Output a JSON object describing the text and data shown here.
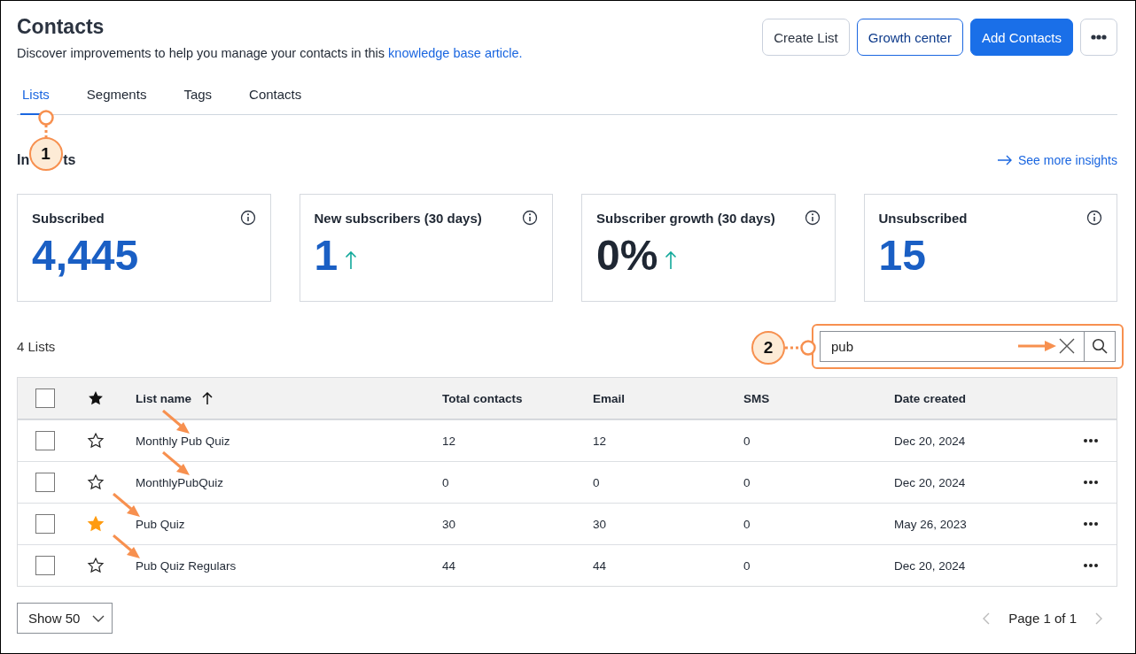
{
  "page": {
    "title": "Contacts",
    "description": "Discover improvements to help you manage your contacts in this ",
    "description_link": "knowledge base article."
  },
  "header_buttons": [
    {
      "label": "Create List",
      "kind": "secondary"
    },
    {
      "label": "Growth center",
      "kind": "outline"
    },
    {
      "label": "Add Contacts",
      "kind": "primary"
    }
  ],
  "tabs": [
    {
      "label": "Lists",
      "selected": true
    },
    {
      "label": "Segments",
      "selected": false
    },
    {
      "label": "Tags",
      "selected": false
    },
    {
      "label": "Contacts",
      "selected": false
    }
  ],
  "insights": {
    "heading_visible_parts": [
      "In",
      "ts"
    ],
    "link": "See more insights"
  },
  "cards": [
    {
      "label": "Subscribed",
      "value": "4,445",
      "kind": "count",
      "trend_up": false
    },
    {
      "label": "New subscribers (30 days)",
      "value": "1",
      "kind": "count",
      "trend_up": true
    },
    {
      "label": "Subscriber growth (30 days)",
      "value": "0%",
      "kind": "percent",
      "trend_up": true
    },
    {
      "label": "Unsubscribed",
      "value": "15",
      "kind": "count",
      "trend_up": false
    }
  ],
  "list_count": "4 Lists",
  "search": {
    "value": "pub"
  },
  "table": {
    "header_checked": false,
    "columns": [
      {
        "label": "List name",
        "sorted": true
      },
      {
        "label": "Total contacts",
        "sorted": false
      },
      {
        "label": "Email",
        "sorted": false
      },
      {
        "label": "SMS",
        "sorted": false
      },
      {
        "label": "Date created",
        "sorted": false
      }
    ],
    "rows": [
      {
        "name": "Monthly Pub Quiz",
        "total": "12",
        "email": "12",
        "sms": "0",
        "date": "Dec 20, 2024",
        "starred": false,
        "checked": false,
        "arrow": true
      },
      {
        "name": "MonthlyPubQuiz",
        "total": "0",
        "email": "0",
        "sms": "0",
        "date": "Dec 20, 2024",
        "starred": false,
        "checked": false,
        "arrow": true
      },
      {
        "name": "Pub Quiz",
        "total": "30",
        "email": "30",
        "sms": "0",
        "date": "May 26, 2023",
        "starred": true,
        "checked": false,
        "arrow": true
      },
      {
        "name": "Pub Quiz Regulars",
        "total": "44",
        "email": "44",
        "sms": "0",
        "date": "Dec 20, 2024",
        "starred": false,
        "checked": false,
        "arrow": true
      }
    ]
  },
  "footer": {
    "page_size": "Show 50",
    "pagination": "Page 1 of 1"
  },
  "callouts": [
    {
      "number": "1"
    },
    {
      "number": "2"
    }
  ]
}
